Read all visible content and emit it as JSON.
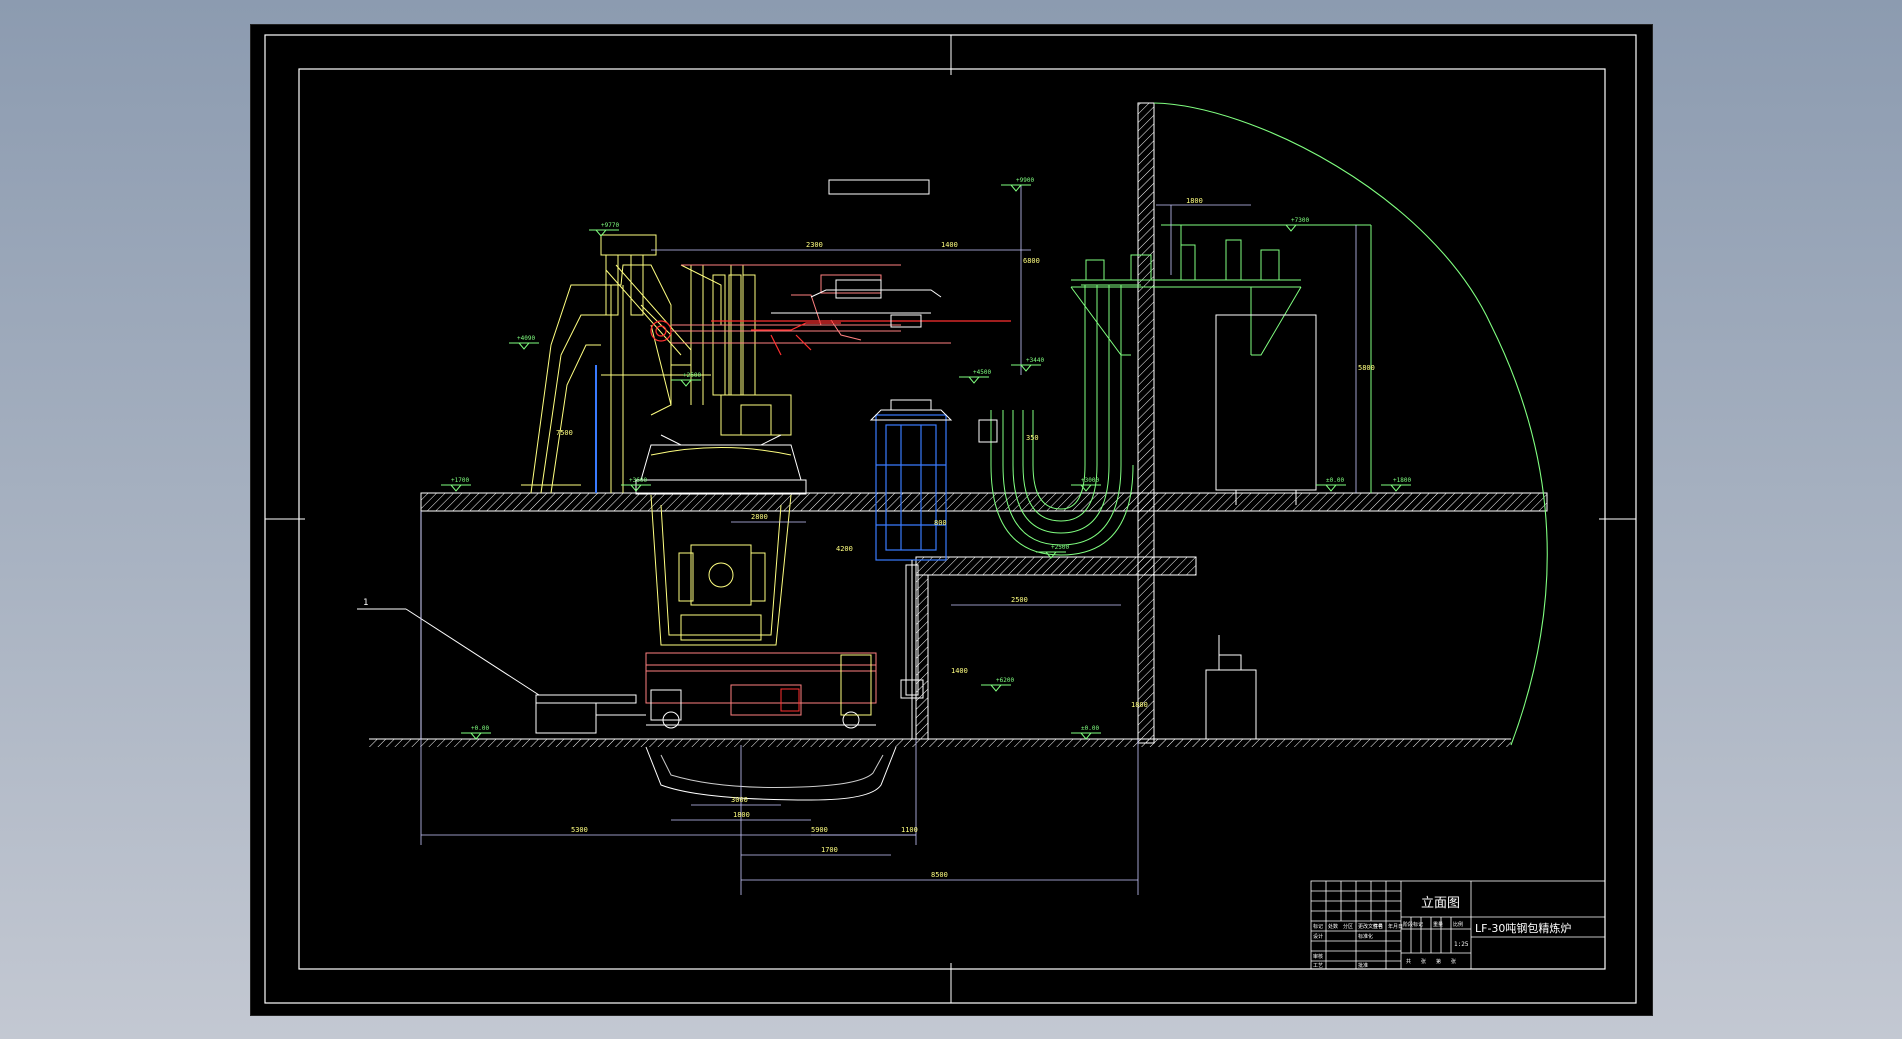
{
  "drawing": {
    "view_title": "立面图",
    "product_title": "LF-30吨钢包精炼炉",
    "scale": "1:25",
    "title_block": {
      "row1": [
        "标记",
        "处数",
        "分区",
        "更改文件号",
        "签名",
        "年月日"
      ],
      "row2": [
        "设计",
        "标准化"
      ],
      "row3": [
        "审核"
      ],
      "row4": [
        "工艺",
        "批准"
      ],
      "stage_cols": [
        "阶段标记",
        "重量",
        "比例"
      ],
      "sheet": [
        "共",
        "张",
        "第",
        "张"
      ]
    },
    "elevations": [
      "+9770",
      "+4090",
      "+9900",
      "+3440",
      "+4500",
      "+1700",
      "+3600",
      "+2500",
      "+3000",
      "+0.00",
      "±0.00",
      "±0.00",
      "+7300",
      "+6200",
      "+1800",
      "+2600"
    ],
    "dimensions": [
      "2300",
      "1400",
      "6800",
      "5800",
      "1800",
      "2800",
      "2500",
      "3000",
      "1800",
      "1100",
      "5300",
      "5900",
      "1700",
      "8500",
      "1400",
      "1800",
      "7500",
      "350",
      "800",
      "4200"
    ],
    "callout": "1"
  },
  "colors": {
    "background": "#000000",
    "frame": "#ffffff",
    "structure": "#ffff80",
    "pink": "#ff8080",
    "green": "#80ff80",
    "cyan": "#00ffff",
    "blue": "#3a7bff",
    "red": "#ff3030",
    "dimension": "#c8c8ff"
  }
}
